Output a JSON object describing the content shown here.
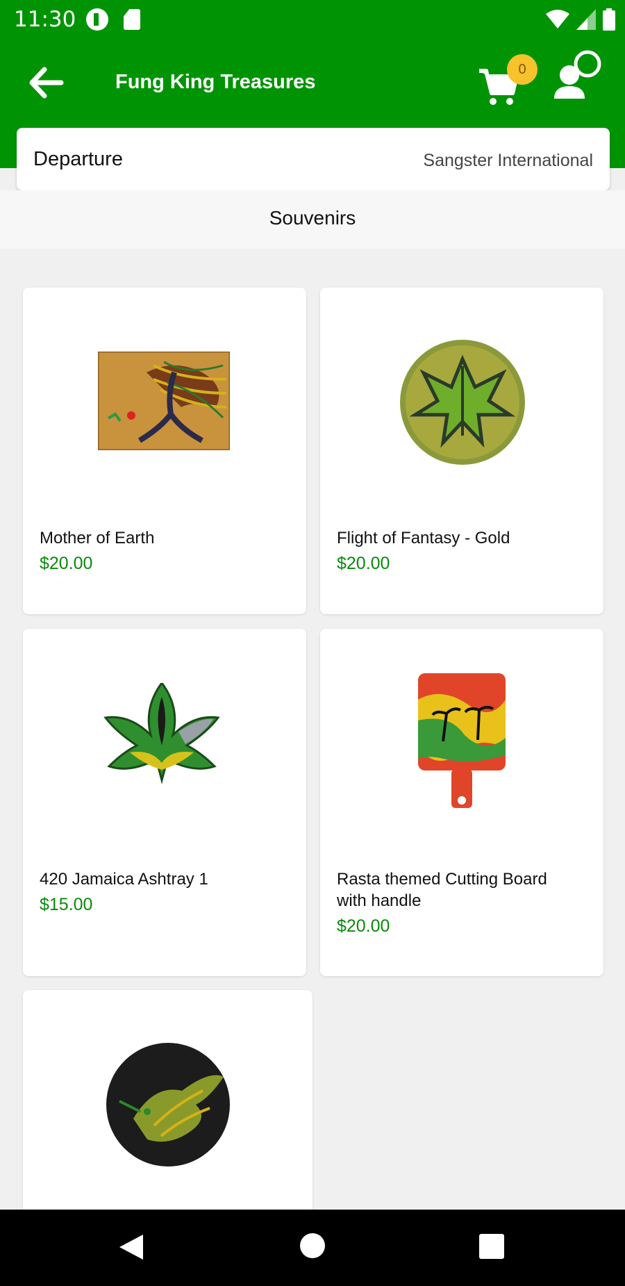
{
  "status_bar": {
    "time": "11:30",
    "icons": [
      "app-notification-icon",
      "sd-card-icon",
      "wifi-icon",
      "signal-icon",
      "battery-icon"
    ]
  },
  "app_bar": {
    "title": "Fung King Treasures",
    "cart_count": "0",
    "icons": [
      "back-arrow-icon",
      "cart-icon",
      "profile-icon"
    ]
  },
  "departure": {
    "label": "Departure",
    "value": "Sangster International"
  },
  "section": {
    "title": "Souvenirs"
  },
  "products": [
    {
      "name": "Mother of Earth",
      "price": "$20.00",
      "image": "painting-thumbnail"
    },
    {
      "name": "Flight of Fantasy - Gold",
      "price": "$20.00",
      "image": "round-leaf-plate-thumbnail"
    },
    {
      "name": "420 Jamaica Ashtray 1",
      "price": "$15.00",
      "image": "leaf-ashtray-thumbnail"
    },
    {
      "name": "Rasta themed Cutting Board with handle",
      "price": "$20.00",
      "image": "cutting-board-thumbnail"
    },
    {
      "name": "",
      "price": "",
      "image": "hummingbird-plate-thumbnail"
    }
  ],
  "colors": {
    "primary": "#009405",
    "price": "#0a8a0a",
    "badge": "#f8c22c",
    "background": "#f0f0f0"
  },
  "nav_bar": {
    "icons": [
      "nav-back-icon",
      "nav-home-icon",
      "nav-recents-icon"
    ]
  }
}
